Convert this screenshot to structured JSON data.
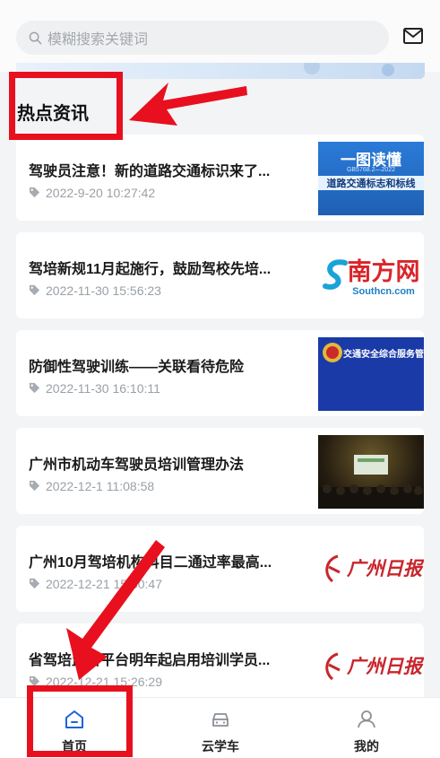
{
  "search": {
    "placeholder": "模糊搜索关键词"
  },
  "section": {
    "title": "热点资讯"
  },
  "news": [
    {
      "title": "驾驶员注意！新的道路交通标识来了...",
      "date": "2022-9-20 10:27:42",
      "thumb_text": [
        "一图读懂",
        "道路交通标志和标线",
        "GB5768.2—2022"
      ]
    },
    {
      "title": "驾培新规11月起施行，鼓励驾校先培...",
      "date": "2022-11-30 15:56:23",
      "thumb_text": [
        "南方网",
        "Southcn.com"
      ]
    },
    {
      "title": "防御性驾驶训练——关联看待危险",
      "date": "2022-11-30 16:10:11",
      "thumb_text": [
        "交通安全综合服务管理平台"
      ]
    },
    {
      "title": "广州市机动车驾驶员培训管理办法",
      "date": "2022-12-1 11:08:58",
      "thumb_text": []
    },
    {
      "title": "广州10月驾培机构科目二通过率最高...",
      "date": "2022-12-21 15:50:47",
      "thumb_text": [
        "广州日报"
      ]
    },
    {
      "title": "省驾培监管平台明年起启用培训学员...",
      "date": "2022-12-21 15:26:29",
      "thumb_text": [
        "广州日报"
      ]
    }
  ],
  "tabbar": [
    {
      "label": "首页",
      "icon": "home-icon",
      "active": true
    },
    {
      "label": "云学车",
      "icon": "car-icon",
      "active": false
    },
    {
      "label": "我的",
      "icon": "user-icon",
      "active": false
    }
  ],
  "colors": {
    "accent": "#e8101e",
    "active_tab": "#1b63d8",
    "date": "#9aa0a6"
  }
}
